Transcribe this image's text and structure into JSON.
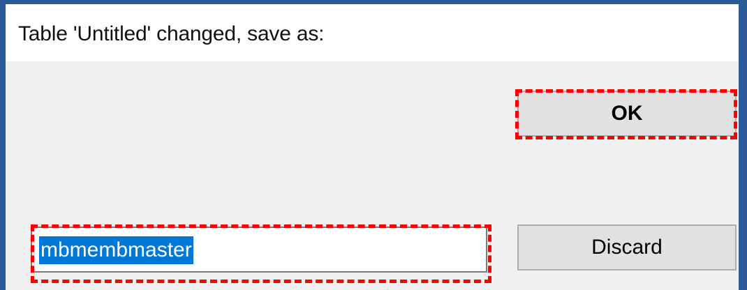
{
  "dialog": {
    "prompt": "Table 'Untitled' changed, save as:",
    "filename_value": "mbmembmaster",
    "ok_label": "OK",
    "discard_label": "Discard"
  },
  "colors": {
    "frame": "#2a5a98",
    "dialog_bg": "#f0f0f0",
    "selection": "#0078d7",
    "highlight": "#ff0000"
  }
}
